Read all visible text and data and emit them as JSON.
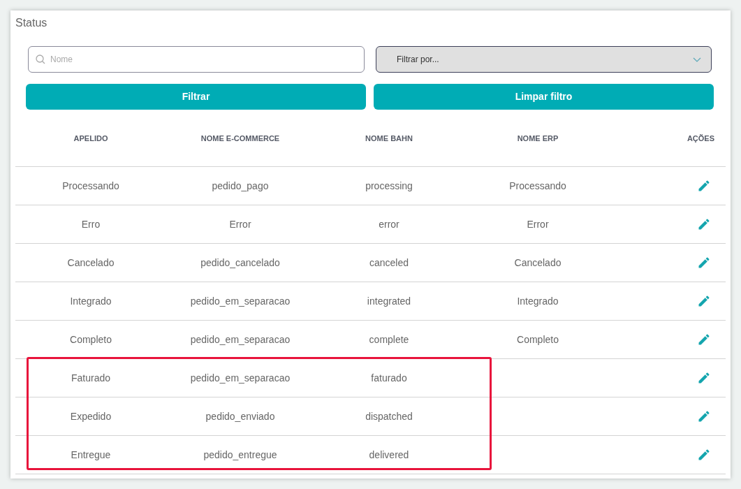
{
  "title": "Status",
  "search": {
    "placeholder": "Nome"
  },
  "filter_select": {
    "value": "Filtrar por..."
  },
  "buttons": [
    "Filtrar",
    "Limpar filtro"
  ],
  "table": {
    "columns": [
      "APELIDO",
      "NOME E-COMMERCE",
      "NOME BAHN",
      "NOME ERP",
      "AÇÕES"
    ],
    "rows": [
      {
        "cells": [
          "Processando",
          "pedido_pago",
          "processing",
          "Processando"
        ],
        "highlighted": false
      },
      {
        "cells": [
          "Erro",
          "Error",
          "error",
          "Error"
        ],
        "highlighted": false
      },
      {
        "cells": [
          "Cancelado",
          "pedido_cancelado",
          "canceled",
          "Cancelado"
        ],
        "highlighted": false
      },
      {
        "cells": [
          "Integrado",
          "pedido_em_separacao",
          "integrated",
          "Integrado"
        ],
        "highlighted": false
      },
      {
        "cells": [
          "Completo",
          "pedido_em_separacao",
          "complete",
          "Completo"
        ],
        "highlighted": false
      },
      {
        "cells": [
          "Faturado",
          "pedido_em_separacao",
          "faturado"
        ],
        "highlighted": true
      },
      {
        "cells": [
          "Expedido",
          "pedido_enviado",
          "dispatched"
        ],
        "highlighted": true
      },
      {
        "cells": [
          "Entregue",
          "pedido_entregue",
          "delivered"
        ],
        "highlighted": true
      }
    ]
  }
}
